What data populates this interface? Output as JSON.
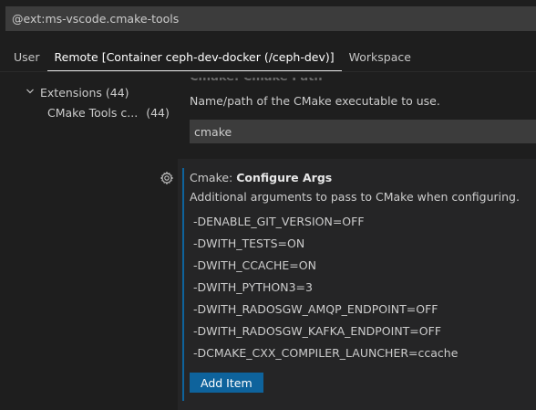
{
  "search": {
    "value": "@ext:ms-vscode.cmake-tools"
  },
  "tabs": [
    {
      "label": "User"
    },
    {
      "label": "Remote [Container ceph-dev-docker (/ceph-dev)]"
    },
    {
      "label": "Workspace"
    }
  ],
  "toc": {
    "extensions_label": "Extensions",
    "extensions_count": "(44)",
    "cmake_label": "CMake Tools c...",
    "cmake_count": "(44)"
  },
  "cmake_path": {
    "title": "Cmake: Cmake Path",
    "description": "Name/path of the CMake executable to use.",
    "value": "cmake"
  },
  "configure_args": {
    "category": "Cmake: ",
    "name": "Configure Args",
    "description": "Additional arguments to pass to CMake when configuring.",
    "items": [
      "-DENABLE_GIT_VERSION=OFF",
      "-DWITH_TESTS=ON",
      "-DWITH_CCACHE=ON",
      "-DWITH_PYTHON3=3",
      "-DWITH_RADOSGW_AMQP_ENDPOINT=OFF",
      "-DWITH_RADOSGW_KAFKA_ENDPOINT=OFF",
      "-DCMAKE_CXX_COMPILER_LAUNCHER=ccache"
    ],
    "add_label": "Add Item"
  },
  "colors": {
    "accent": "#0e639c",
    "background": "#1e1e1e",
    "panel": "#252526",
    "input": "#3c3c3c"
  }
}
